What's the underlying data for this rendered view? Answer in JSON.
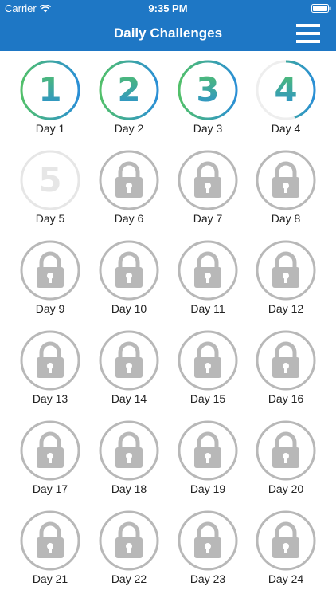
{
  "status_bar": {
    "carrier": "Carrier",
    "time": "9:35 PM"
  },
  "nav": {
    "title": "Daily Challenges"
  },
  "colors": {
    "header": "#1e77c5",
    "ring_start": "#52c06a",
    "ring_end": "#2a8fd6",
    "locked": "#b8b8b8",
    "faded": "#e6e6e6"
  },
  "days": [
    {
      "label": "Day 1",
      "number": "1",
      "status": "completed",
      "progress": 1.0
    },
    {
      "label": "Day 2",
      "number": "2",
      "status": "completed",
      "progress": 1.0
    },
    {
      "label": "Day 3",
      "number": "3",
      "status": "completed",
      "progress": 1.0
    },
    {
      "label": "Day 4",
      "number": "4",
      "status": "in-progress",
      "progress": 0.45
    },
    {
      "label": "Day 5",
      "number": "5",
      "status": "available",
      "progress": 0
    },
    {
      "label": "Day 6",
      "status": "locked"
    },
    {
      "label": "Day 7",
      "status": "locked"
    },
    {
      "label": "Day 8",
      "status": "locked"
    },
    {
      "label": "Day 9",
      "status": "locked"
    },
    {
      "label": "Day 10",
      "status": "locked"
    },
    {
      "label": "Day 11",
      "status": "locked"
    },
    {
      "label": "Day 12",
      "status": "locked"
    },
    {
      "label": "Day 13",
      "status": "locked"
    },
    {
      "label": "Day 14",
      "status": "locked"
    },
    {
      "label": "Day 15",
      "status": "locked"
    },
    {
      "label": "Day 16",
      "status": "locked"
    },
    {
      "label": "Day 17",
      "status": "locked"
    },
    {
      "label": "Day 18",
      "status": "locked"
    },
    {
      "label": "Day 19",
      "status": "locked"
    },
    {
      "label": "Day 20",
      "status": "locked"
    },
    {
      "label": "Day 21",
      "status": "locked"
    },
    {
      "label": "Day 22",
      "status": "locked"
    },
    {
      "label": "Day 23",
      "status": "locked"
    },
    {
      "label": "Day 24",
      "status": "locked"
    }
  ]
}
